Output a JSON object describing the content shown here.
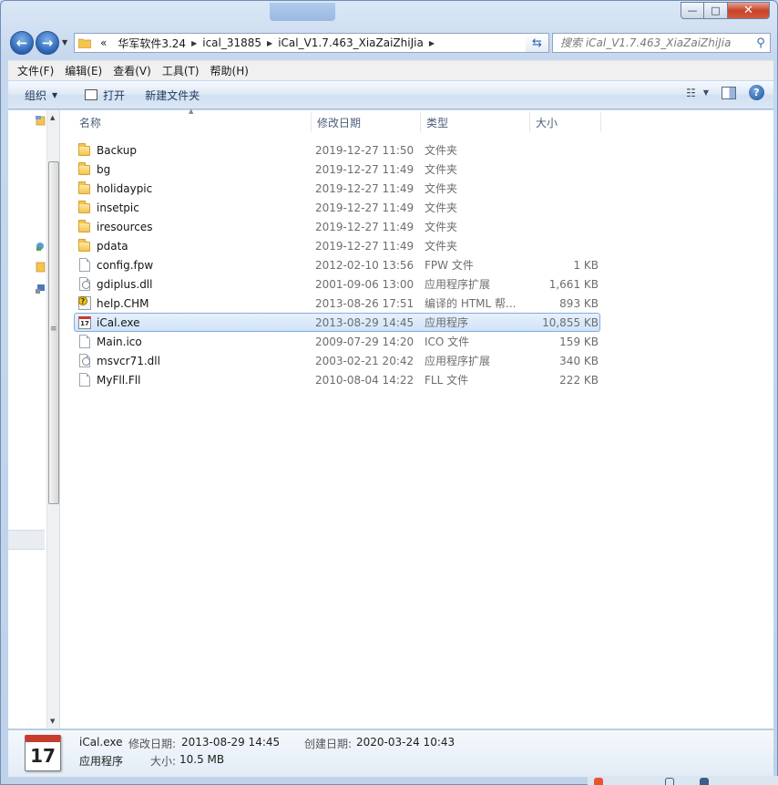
{
  "window": {
    "controls": {
      "minimize": "—",
      "maximize": "□",
      "close": "✕"
    }
  },
  "address_bar": {
    "overflow": "«",
    "crumbs": [
      "华军软件3.24",
      "ical_31885",
      "iCal_V1.7.463_XiaZaiZhiJia"
    ],
    "search_placeholder": "搜索 iCal_V1.7.463_XiaZaiZhiJia"
  },
  "menu": [
    "文件(F)",
    "编辑(E)",
    "查看(V)",
    "工具(T)",
    "帮助(H)"
  ],
  "toolbar": {
    "organize": "组织",
    "open": "打开",
    "new_folder": "新建文件夹"
  },
  "columns": {
    "name": "名称",
    "date": "修改日期",
    "type": "类型",
    "size": "大小"
  },
  "files": [
    {
      "name": "Backup",
      "date": "2019-12-27 11:50",
      "type": "文件夹",
      "size": "",
      "icon": "folder-icon"
    },
    {
      "name": "bg",
      "date": "2019-12-27 11:49",
      "type": "文件夹",
      "size": "",
      "icon": "folder-icon"
    },
    {
      "name": "holidaypic",
      "date": "2019-12-27 11:49",
      "type": "文件夹",
      "size": "",
      "icon": "folder-icon"
    },
    {
      "name": "insetpic",
      "date": "2019-12-27 11:49",
      "type": "文件夹",
      "size": "",
      "icon": "folder-icon"
    },
    {
      "name": "iresources",
      "date": "2019-12-27 11:49",
      "type": "文件夹",
      "size": "",
      "icon": "folder-icon"
    },
    {
      "name": "pdata",
      "date": "2019-12-27 11:49",
      "type": "文件夹",
      "size": "",
      "icon": "folder-icon"
    },
    {
      "name": "config.fpw",
      "date": "2012-02-10 13:56",
      "type": "FPW 文件",
      "size": "1 KB",
      "icon": "file-icon"
    },
    {
      "name": "gdiplus.dll",
      "date": "2001-09-06 13:00",
      "type": "应用程序扩展",
      "size": "1,661 KB",
      "icon": "dll-icon"
    },
    {
      "name": "help.CHM",
      "date": "2013-08-26 17:51",
      "type": "编译的 HTML 帮...",
      "size": "893 KB",
      "icon": "chm-help-icon"
    },
    {
      "name": "iCal.exe",
      "date": "2013-08-29 14:45",
      "type": "应用程序",
      "size": "10,855 KB",
      "icon": "calendar-app-icon",
      "selected": true
    },
    {
      "name": "Main.ico",
      "date": "2009-07-29 14:20",
      "type": "ICO 文件",
      "size": "159 KB",
      "icon": "file-icon"
    },
    {
      "name": "msvcr71.dll",
      "date": "2003-02-21 20:42",
      "type": "应用程序扩展",
      "size": "340 KB",
      "icon": "dll-icon"
    },
    {
      "name": "MyFll.Fll",
      "date": "2010-08-04 14:22",
      "type": "FLL 文件",
      "size": "222 KB",
      "icon": "file-icon"
    }
  ],
  "details": {
    "icon_text": "17",
    "name": "iCal.exe",
    "type": "应用程序",
    "modified_label": "修改日期:",
    "modified_value": "2013-08-29 14:45",
    "created_label": "创建日期:",
    "created_value": "2020-03-24 10:43",
    "size_label": "大小:",
    "size_value": "10.5 MB"
  },
  "colors": {
    "selection": "#cfe3fa",
    "selection_border": "#84acdd",
    "accent": "#2a63b6"
  }
}
